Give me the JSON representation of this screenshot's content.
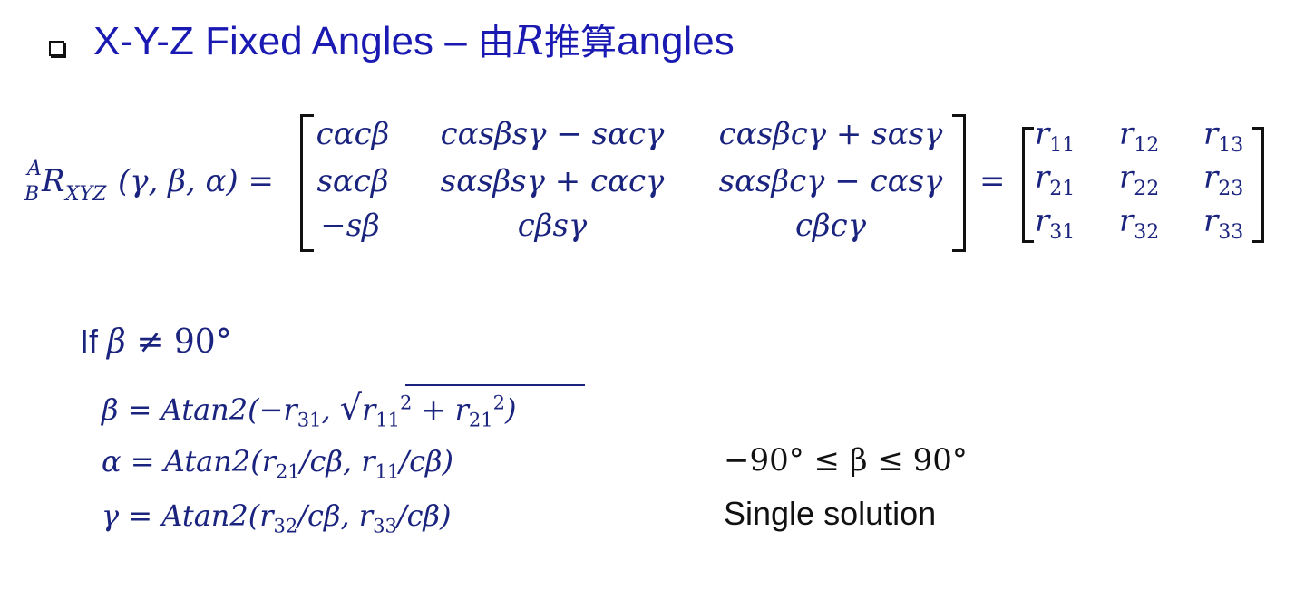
{
  "slide": {
    "title_prefix": "X-Y-Z Fixed Angles – ",
    "title_cjk_1": "由",
    "title_var": "R",
    "title_cjk_2": "推算",
    "title_suffix": "angles"
  },
  "equation": {
    "lhs_sup": "A",
    "lhs_sub_left": "B",
    "lhs_symbol": "R",
    "lhs_sub": "XYZ",
    "lhs_args": "(γ, β, α) =",
    "matrix": [
      [
        "cαcβ",
        "cαsβsγ − sαcγ",
        "cαsβcγ + sαsγ"
      ],
      [
        "sαcβ",
        "sαsβsγ + cαcγ",
        "sαsβcγ − cαsγ"
      ],
      [
        "−sβ",
        "cβsγ",
        "cβcγ"
      ]
    ],
    "equals": "=",
    "r_matrix": [
      [
        "11",
        "12",
        "13"
      ],
      [
        "21",
        "22",
        "23"
      ],
      [
        "31",
        "32",
        "33"
      ]
    ],
    "r_symbol": "r"
  },
  "condition": {
    "if_word": "If ",
    "beta": "β",
    "rest": " ≠ 90°"
  },
  "solutions": {
    "beta_line": {
      "lhs": "β = Atan2(−r",
      "sub1": "31",
      "mid": ", ",
      "r11": "r",
      "s11": "11",
      "plus": " + r",
      "s21": "21",
      "sq": "2",
      "close": ")"
    },
    "alpha_line": {
      "text_a": "α = Atan2(r",
      "s1": "21",
      "text_b": "/cβ, r",
      "s2": "11",
      "text_c": "/cβ)"
    },
    "gamma_line": {
      "text_a": "γ = Atan2(r",
      "s1": "32",
      "text_b": "/cβ, r",
      "s2": "33",
      "text_c": "/cβ)"
    }
  },
  "notes": {
    "range": "−90° ≤ β ≤ 90°",
    "single_solution": "Single solution"
  }
}
